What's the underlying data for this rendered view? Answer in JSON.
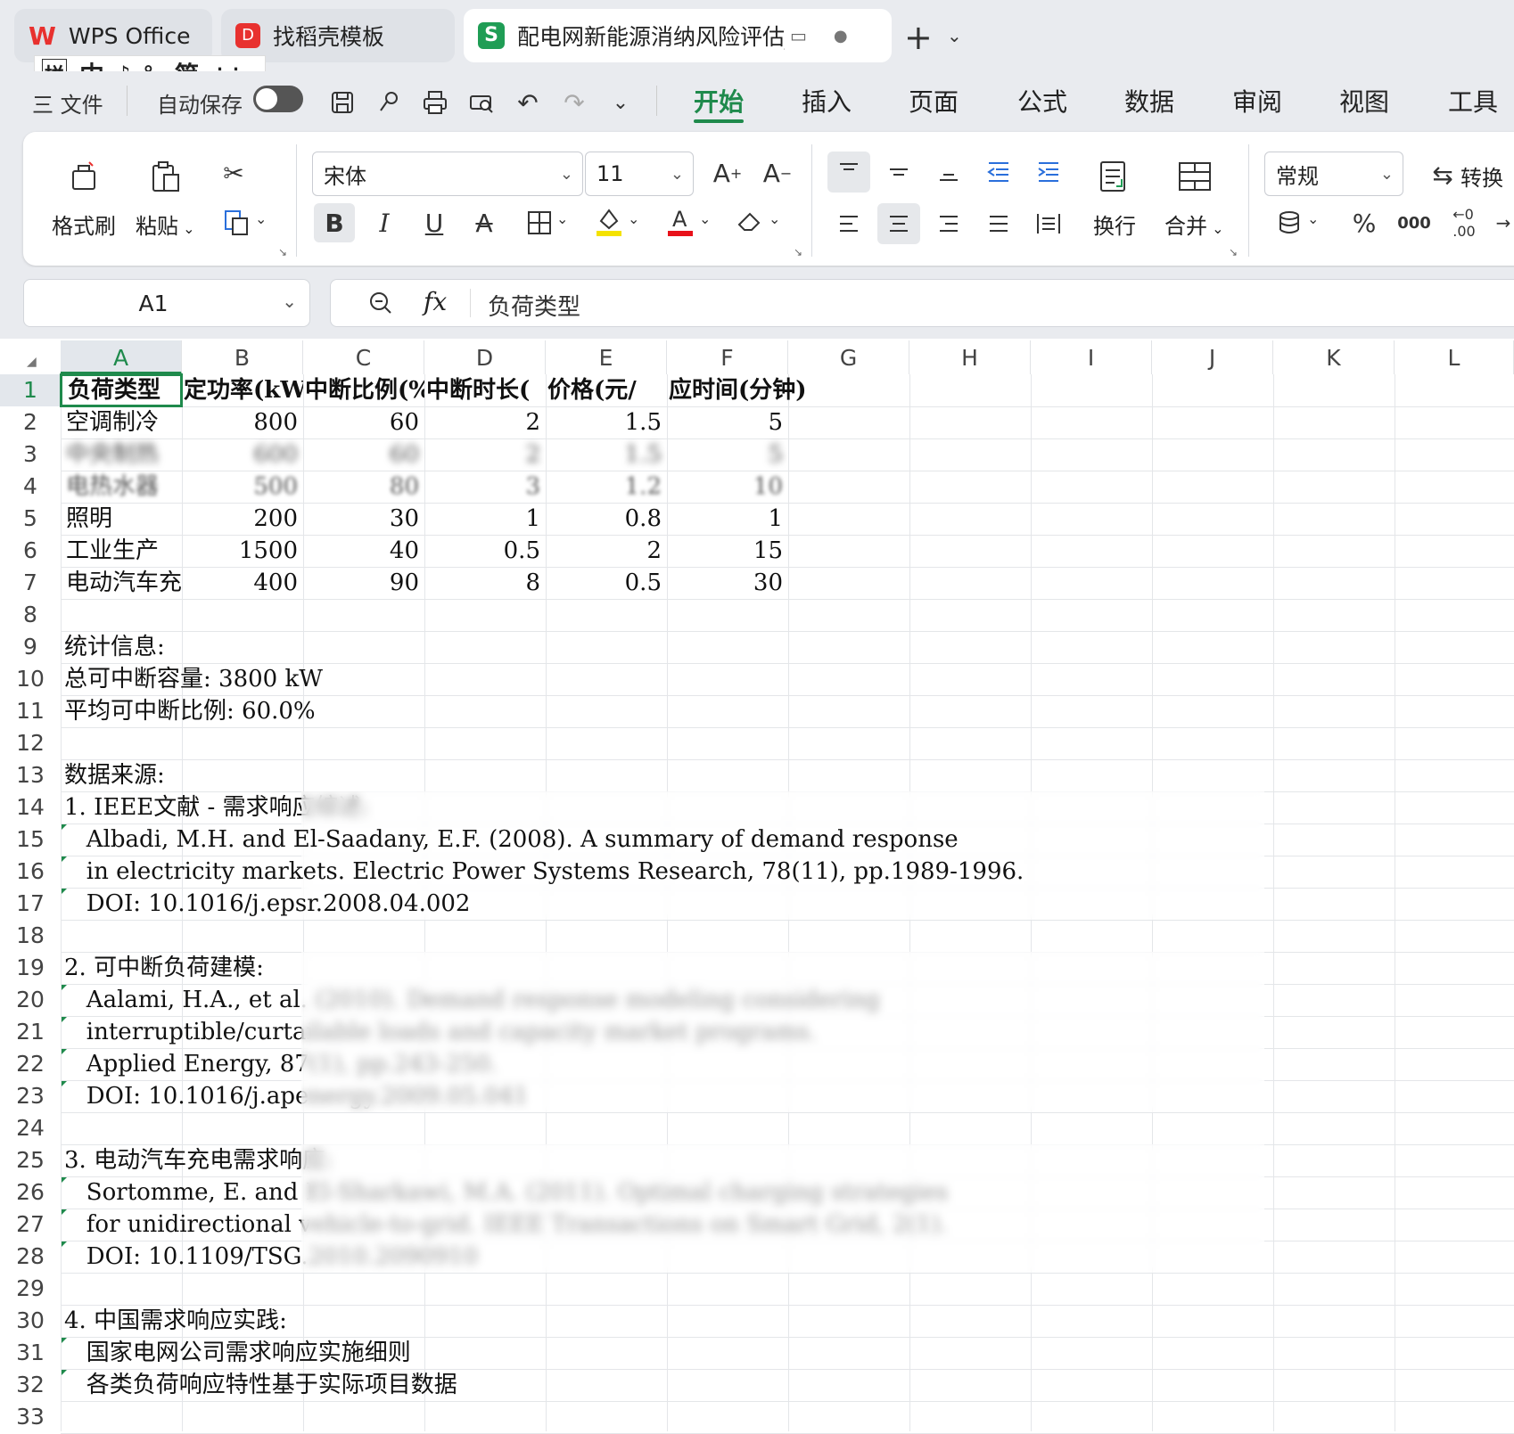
{
  "tabs": [
    {
      "label": "WPS Office",
      "icon": "wps-logo-icon",
      "active": false
    },
    {
      "label": "找稻壳模板",
      "icon": "docer-logo-icon",
      "active": false
    },
    {
      "label": "配电网新能源消纳风险评估_完",
      "icon": "spreadsheet-s-icon",
      "active": true
    }
  ],
  "ime_bar": {
    "items": [
      "拼",
      "中",
      "♪",
      "°,",
      "简",
      "⋮⋮"
    ]
  },
  "quickbar": {
    "file_label": "三 文件",
    "autosave_label": "自动保存",
    "autosave_on": false
  },
  "menu_tabs": [
    "开始",
    "插入",
    "页面",
    "公式",
    "数据",
    "审阅",
    "视图",
    "工具"
  ],
  "menu_active": "开始",
  "ribbon": {
    "format_painter": "格式刷",
    "paste": "粘贴",
    "font_name": "宋体",
    "font_size": "11",
    "wrap": "换行",
    "merge": "合并",
    "number_format": "常规",
    "convert": "转换"
  },
  "formula_bar": {
    "cell_ref": "A1",
    "fx": "fx",
    "content": "负荷类型"
  },
  "columns": [
    "A",
    "B",
    "C",
    "D",
    "E",
    "F",
    "G",
    "H",
    "I",
    "J",
    "K",
    "L"
  ],
  "selected_column": "A",
  "rows": [
    "1",
    "2",
    "3",
    "4",
    "5",
    "6",
    "7",
    "8",
    "9",
    "10",
    "11",
    "12",
    "13",
    "14",
    "15",
    "16",
    "17",
    "18",
    "19",
    "20",
    "21",
    "22",
    "23",
    "24",
    "25",
    "26",
    "27",
    "28",
    "29",
    "30",
    "31",
    "32",
    "33"
  ],
  "table": {
    "headers": [
      "负荷类型",
      "定功率(kW",
      "中断比例(%",
      "中断时长(",
      "价格(元/",
      "应时间(分钟)"
    ],
    "rows": [
      [
        "空调制冷",
        "800",
        "60",
        "2",
        "1.5",
        "5"
      ],
      [
        "中央制热",
        "600",
        "60",
        "2",
        "1.5",
        "5"
      ],
      [
        "电热水器",
        "500",
        "80",
        "3",
        "1.2",
        "10"
      ],
      [
        "照明",
        "200",
        "30",
        "1",
        "0.8",
        "1"
      ],
      [
        "工业生产",
        "1500",
        "40",
        "0.5",
        "2",
        "15"
      ],
      [
        "电动汽车充",
        "400",
        "90",
        "8",
        "0.5",
        "30"
      ]
    ]
  },
  "notes": {
    "stats_title": "统计信息:",
    "total_capacity": "总可中断容量: 3800 kW",
    "avg_ratio": "平均可中断比例: 60.0%",
    "source_title": "数据来源:",
    "ref1_title": "1. IEEE文献 - 需求响应综述:",
    "ref1_line1": "   Albadi, M.H. and El-Saadany, E.F. (2008). A summary of demand response",
    "ref1_line2": "   in electricity markets. Electric Power Systems Research, 78(11), pp.1989-1996.",
    "ref1_line3": "   DOI: 10.1016/j.epsr.2008.04.002",
    "ref2_title": "2. 可中断负荷建模:",
    "ref2_line1": "   Aalami, H.A., et al. (2010). Demand response modeling considering",
    "ref2_line2": "   interruptible/curtailable loads and capacity market programs.",
    "ref2_line3": "   Applied Energy, 87(1), pp.243-250.",
    "ref2_line4": "   DOI: 10.1016/j.apenergy.2009.05.041",
    "ref3_title": "3. 电动汽车充电需求响应:",
    "ref3_line1": "   Sortomme, E. and El-Sharkawi, M.A. (2011). Optimal charging strategies",
    "ref3_line2": "   for unidirectional vehicle-to-grid. IEEE Transactions on Smart Grid, 2(1).",
    "ref3_line3": "   DOI: 10.1109/TSG.2010.2090910",
    "ref4_title": "4. 中国需求响应实践:",
    "ref4_line1": "   国家电网公司需求响应实施细则",
    "ref4_line2": "   各类负荷响应特性基于实际项目数据"
  }
}
